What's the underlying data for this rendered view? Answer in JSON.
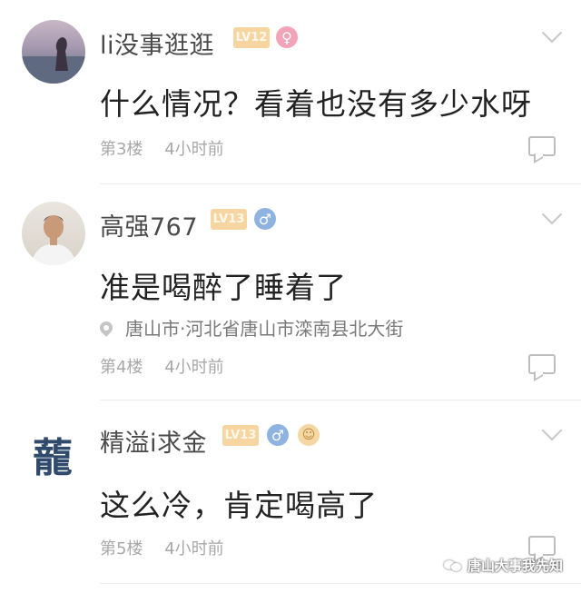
{
  "comments": [
    {
      "username": "li没事逛逛",
      "level": "LV12",
      "gender_icon": "female-icon",
      "gender_symbol": "♀",
      "content": "什么情况？看着也没有多少水呀",
      "floor": "第3楼",
      "time": "4小时前"
    },
    {
      "username": "高强767",
      "level": "LV13",
      "gender_icon": "male-icon",
      "gender_symbol": "♂",
      "content": "准是喝醉了睡着了",
      "location": "唐山市·河北省唐山市滦南县北大街",
      "floor": "第4楼",
      "time": "4小时前"
    },
    {
      "username": "精溢i求金",
      "level": "LV13",
      "gender_icon": "male-icon",
      "gender_symbol": "♂",
      "extra_badge_icon": "emoji-badge-icon",
      "content": "这么冷，肯定喝高了",
      "floor": "第5楼",
      "time": "4小时前",
      "avatar_text": "蘢"
    }
  ],
  "watermark": {
    "text": "唐山大事我先知",
    "icon": "wechat-icon"
  },
  "colors": {
    "level_badge": "#f6d5a1",
    "female": "#f3a3b8",
    "male": "#8fb3e0",
    "meta_text": "#a8a8a8"
  }
}
